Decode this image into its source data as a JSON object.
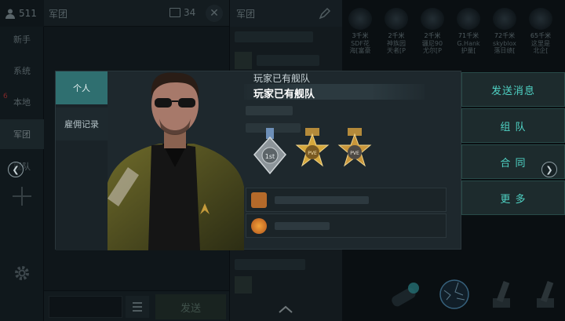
{
  "user": {
    "count": "511"
  },
  "nav": {
    "items": [
      {
        "label": "新手"
      },
      {
        "label": "系统"
      },
      {
        "label": "本地",
        "badge": "6"
      },
      {
        "label": "军团"
      },
      {
        "label": "舰队"
      }
    ]
  },
  "chat": {
    "title": "军团",
    "member_count": "34",
    "send_label": "发送"
  },
  "corp": {
    "title": "军团"
  },
  "overview": {
    "items": [
      {
        "distance": "3千米",
        "name1": "SDF花",
        "name2": "海[富豪"
      },
      {
        "distance": "2千米",
        "name1": "神族园",
        "name2": "天者[P"
      },
      {
        "distance": "2千米",
        "name1": "疆尼90",
        "name2": "尤尔[P"
      },
      {
        "distance": "71千米",
        "name1": "G.Hank",
        "name2": "护量["
      },
      {
        "distance": "72千米",
        "name1": "skyblox",
        "name2": "落日绩["
      },
      {
        "distance": "65千米",
        "name1": "这里是",
        "name2": "北企["
      }
    ]
  },
  "modal": {
    "tabs": {
      "personal": "个人",
      "hire_record": "雇佣记录"
    },
    "name_line1": "玩家已有舰队",
    "name_line2": "玩家已有舰队",
    "medals": [
      {
        "label": "1st"
      },
      {
        "label": "PVE"
      },
      {
        "label": "PVE"
      }
    ],
    "actions": {
      "send_message": "发送消息",
      "team": "组 队",
      "contract": "合 同",
      "more": "更 多"
    }
  },
  "colors": {
    "accent_teal": "#2f6f70",
    "action_text": "#4fd2c4",
    "gold": "#d6a83c"
  }
}
